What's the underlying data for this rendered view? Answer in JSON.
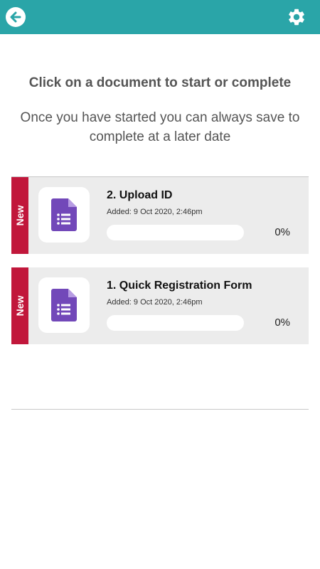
{
  "topbar": {
    "back_icon": "arrow-left-icon",
    "settings_icon": "gear-icon",
    "color": "#2aa5a8"
  },
  "main": {
    "heading": "Click on a document to start or complete",
    "subheading": "Once you have started you can always save to complete at a later date"
  },
  "documents": [
    {
      "badge": "New",
      "title": "2. Upload ID",
      "added": "Added: 9 Oct 2020, 2:46pm",
      "progress_label": "0%",
      "progress": 0,
      "icon": "google-forms-icon"
    },
    {
      "badge": "New",
      "title": "1. Quick Registration Form",
      "added": "Added: 9 Oct 2020, 2:46pm",
      "progress_label": "0%",
      "progress": 0,
      "icon": "google-forms-icon"
    }
  ],
  "colors": {
    "badge": "#c1173b",
    "card": "#ececec",
    "doc_icon": "#7248b9"
  }
}
